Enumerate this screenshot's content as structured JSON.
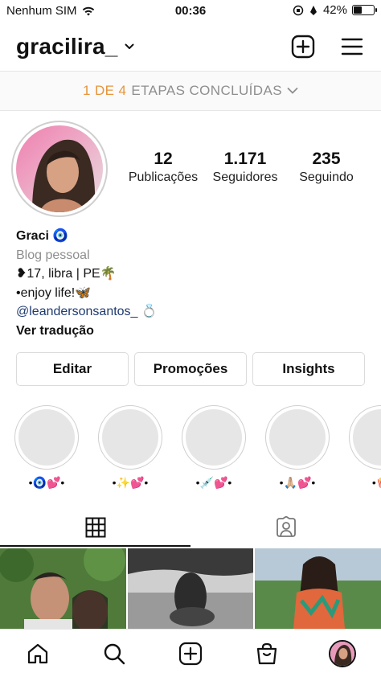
{
  "status_bar": {
    "carrier": "Nenhum SIM",
    "time": "00:36",
    "battery": "42%",
    "battery_level": 0.42
  },
  "header": {
    "username": "gracilira_",
    "icons": [
      "chevron-down-icon",
      "new-post-icon",
      "menu-icon"
    ]
  },
  "steps": {
    "progress": "1 DE 4",
    "label": "ETAPAS CONCLUÍDAS",
    "accent_color": "#e8943a"
  },
  "stats": {
    "posts": {
      "value": "12",
      "label": "Publicações"
    },
    "followers": {
      "value": "1.171",
      "label": "Seguidores"
    },
    "following": {
      "value": "235",
      "label": "Seguindo"
    }
  },
  "bio": {
    "name": "Graci 🧿",
    "category": "Blog pessoal",
    "line1": "❥17, libra | PE🌴",
    "line2": "•enjoy life!🦋",
    "mention": "@leandersonsantos_ 💍",
    "translate": "Ver tradução"
  },
  "buttons": {
    "edit": "Editar",
    "promotions": "Promoções",
    "insights": "Insights"
  },
  "highlights": [
    {
      "label": "•🧿💕•"
    },
    {
      "label": "•✨💕•"
    },
    {
      "label": "•💉💕•"
    },
    {
      "label": "•🙏🏼💕•"
    },
    {
      "label": "•🍿"
    }
  ],
  "tabs": [
    "grid-icon",
    "tagged-icon"
  ],
  "bottom_nav": [
    "home-icon",
    "search-icon",
    "create-icon",
    "shop-icon",
    "profile-avatar"
  ]
}
